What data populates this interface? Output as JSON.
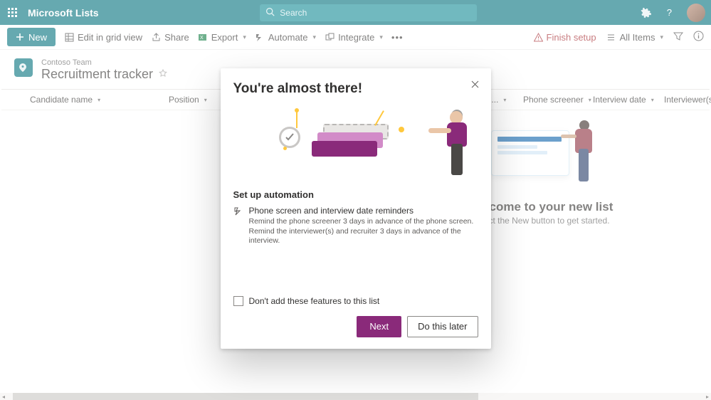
{
  "app": {
    "name": "Microsoft Lists"
  },
  "search": {
    "placeholder": "Search"
  },
  "commands": {
    "new": "New",
    "editGrid": "Edit in grid view",
    "share": "Share",
    "export": "Export",
    "automate": "Automate",
    "integrate": "Integrate",
    "finishSetup": "Finish setup",
    "allItems": "All Items"
  },
  "header": {
    "breadcrumb": "Contoso Team",
    "title": "Recruitment tracker"
  },
  "columns": {
    "candidate": "Candidate name",
    "position": "Position",
    "screenDate": "en d...",
    "phoneScreener": "Phone screener",
    "interviewDate": "Interview date",
    "interviewers": "Interviewer(s)"
  },
  "empty": {
    "title": "Welcome to your new list",
    "subtitle": "Select the New button to get started."
  },
  "modal": {
    "title": "You're almost there!",
    "section": "Set up automation",
    "rule": {
      "title": "Phone screen and interview date reminders",
      "desc": "Remind the phone screener 3 days in advance of the phone screen. Remind the interviewer(s) and recruiter 3 days in advance of the interview."
    },
    "checkbox": "Don't add these features to this list",
    "next": "Next",
    "later": "Do this later"
  }
}
